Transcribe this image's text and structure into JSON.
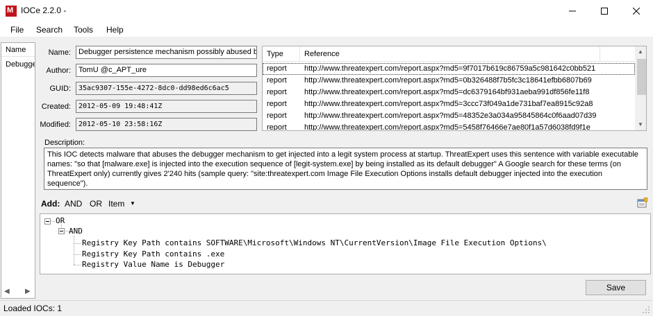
{
  "window": {
    "title": "IOCe 2.2.0 -"
  },
  "menu": {
    "items": [
      "File",
      "Search",
      "Tools",
      "Help"
    ]
  },
  "left_list": {
    "header": "Name",
    "rows": [
      "Debugger"
    ]
  },
  "fields": {
    "name_label": "Name:",
    "name_value": "Debugger persistence mechanism possibly abused by",
    "author_label": "Author:",
    "author_value": "TomU @c_APT_ure",
    "guid_label": "GUID:",
    "guid_value": "35ac9307-155e-4272-8dc0-dd98ed6c6ac5",
    "created_label": "Created:",
    "created_value": "2012-05-09 19:48:41Z",
    "modified_label": "Modified:",
    "modified_value": "2012-05-10 23:58:16Z"
  },
  "references": {
    "columns": [
      "Type",
      "Reference"
    ],
    "rows": [
      {
        "type": "report",
        "url": "http://www.threatexpert.com/report.aspx?md5=9f7017b619c86759a5c981642c0bb521"
      },
      {
        "type": "report",
        "url": "http://www.threatexpert.com/report.aspx?md5=0b326488f7b5fc3c18641efbb6807b69"
      },
      {
        "type": "report",
        "url": "http://www.threatexpert.com/report.aspx?md5=dc6379164bf931aeba991df856fe11f8"
      },
      {
        "type": "report",
        "url": "http://www.threatexpert.com/report.aspx?md5=3ccc73f049a1de731baf7ea8915c92a8"
      },
      {
        "type": "report",
        "url": "http://www.threatexpert.com/report.aspx?md5=48352e3a034a95845864c0f6aad07d39"
      },
      {
        "type": "report",
        "url": "http://www.threatexpert.com/report.aspx?md5=5458f76466e7ae80f1a57d6038fd9f1e"
      }
    ]
  },
  "description": {
    "label": "Description:",
    "text": "This IOC detects malware that abuses the debugger mechanism to get injected into a legit system process at startup. ThreatExpert uses this sentence with variable executable names: \"so that [malware.exe] is injected into the execution sequence of [legit-system.exe] by being installed as its default debugger\" A Google search for these terms (on ThreatExpert only) currently gives 2'240 hits (sample query: \"site:threatexpert.com Image File Execution Options installs default debugger injected into the execution sequence\")."
  },
  "toolbar": {
    "add_label": "Add:",
    "and_label": "AND",
    "or_label": "OR",
    "item_label": "Item"
  },
  "tree": {
    "or": "OR",
    "and": "AND",
    "items": [
      "Registry Key Path contains SOFTWARE\\Microsoft\\Windows NT\\CurrentVersion\\Image File Execution Options\\",
      "Registry Key Path contains .exe",
      "Registry Value Name is Debugger"
    ]
  },
  "save_label": "Save",
  "status": {
    "text": "Loaded IOCs: 1"
  },
  "colors": {
    "app_icon": "#c0141c",
    "window_bg": "#f0f0f0"
  }
}
